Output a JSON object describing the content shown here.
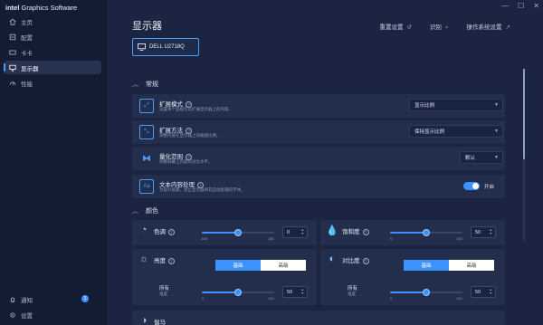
{
  "app": {
    "brand_intel": "intel",
    "brand_rest": " Graphics Software",
    "accent": "#3c93ff"
  },
  "window_controls": {
    "minimize": "—",
    "maximize": "☐",
    "close": "✕"
  },
  "sidebar": {
    "items": [
      {
        "label": "主页",
        "icon": "home-icon",
        "active": false
      },
      {
        "label": "配置",
        "icon": "profile-icon",
        "active": false
      },
      {
        "label": "卡卡",
        "icon": "card-icon",
        "active": false
      },
      {
        "label": "显示器",
        "icon": "monitor-icon",
        "active": true
      },
      {
        "label": "性能",
        "icon": "performance-icon",
        "active": false
      }
    ],
    "bottom": [
      {
        "label": "通知",
        "icon": "bell-icon",
        "badge": "1"
      },
      {
        "label": "设置",
        "icon": "gear-icon"
      }
    ]
  },
  "header": {
    "title": "显示器",
    "actions": [
      {
        "label": "重置设置",
        "icon": "reset-icon"
      },
      {
        "label": "识别",
        "icon": "search-icon"
      },
      {
        "label": "操作系统设置",
        "icon": "external-link-icon"
      }
    ]
  },
  "monitor": {
    "name": "DELL U2718Q",
    "icon": "monitor-icon"
  },
  "general": {
    "title": "常规",
    "rows": [
      {
        "title": "扩展模式",
        "desc": "设置将个监视可以扩展显示器上的内容。",
        "control": "select",
        "value": "显示比例",
        "icon": "scale-mode-icon"
      },
      {
        "title": "扩展方法",
        "desc": "调整内容在显示器上的缩放比例。",
        "control": "select",
        "value": "保持显示比例",
        "icon": "scale-method-icon"
      },
      {
        "title": "量化范围",
        "desc": "调整屏幕上内容的对比水平。",
        "control": "select",
        "value": "默认",
        "icon": "quantization-icon"
      },
      {
        "title": "文本内容处理",
        "desc": "为提升质量，禁止显示器将其自动处理的字体。",
        "control": "toggle",
        "value": "开启",
        "icon": "text-icon"
      }
    ]
  },
  "color": {
    "title": "颜色",
    "hue": {
      "label": "色调",
      "min": "-180",
      "max": "180",
      "value": "0",
      "fraction": 0.5,
      "icon": "hue-icon"
    },
    "saturation": {
      "label": "饱和度",
      "min": "0",
      "max": "100",
      "value": "50",
      "fraction": 0.5,
      "icon": "saturation-icon"
    },
    "brightness": {
      "label": "亮度",
      "icon": "brightness-icon",
      "seg_basic": "基础",
      "seg_advanced": "高级",
      "channel": "所有",
      "channel_sub": "强度",
      "min": "0",
      "max": "100",
      "value": "50",
      "fraction": 0.5
    },
    "contrast": {
      "label": "对比度",
      "icon": "contrast-icon",
      "seg_basic": "基础",
      "seg_advanced": "高级",
      "channel": "所有",
      "channel_sub": "强度",
      "min": "0",
      "max": "100",
      "value": "50",
      "fraction": 0.5
    },
    "gamma": {
      "label": "伽马"
    }
  }
}
